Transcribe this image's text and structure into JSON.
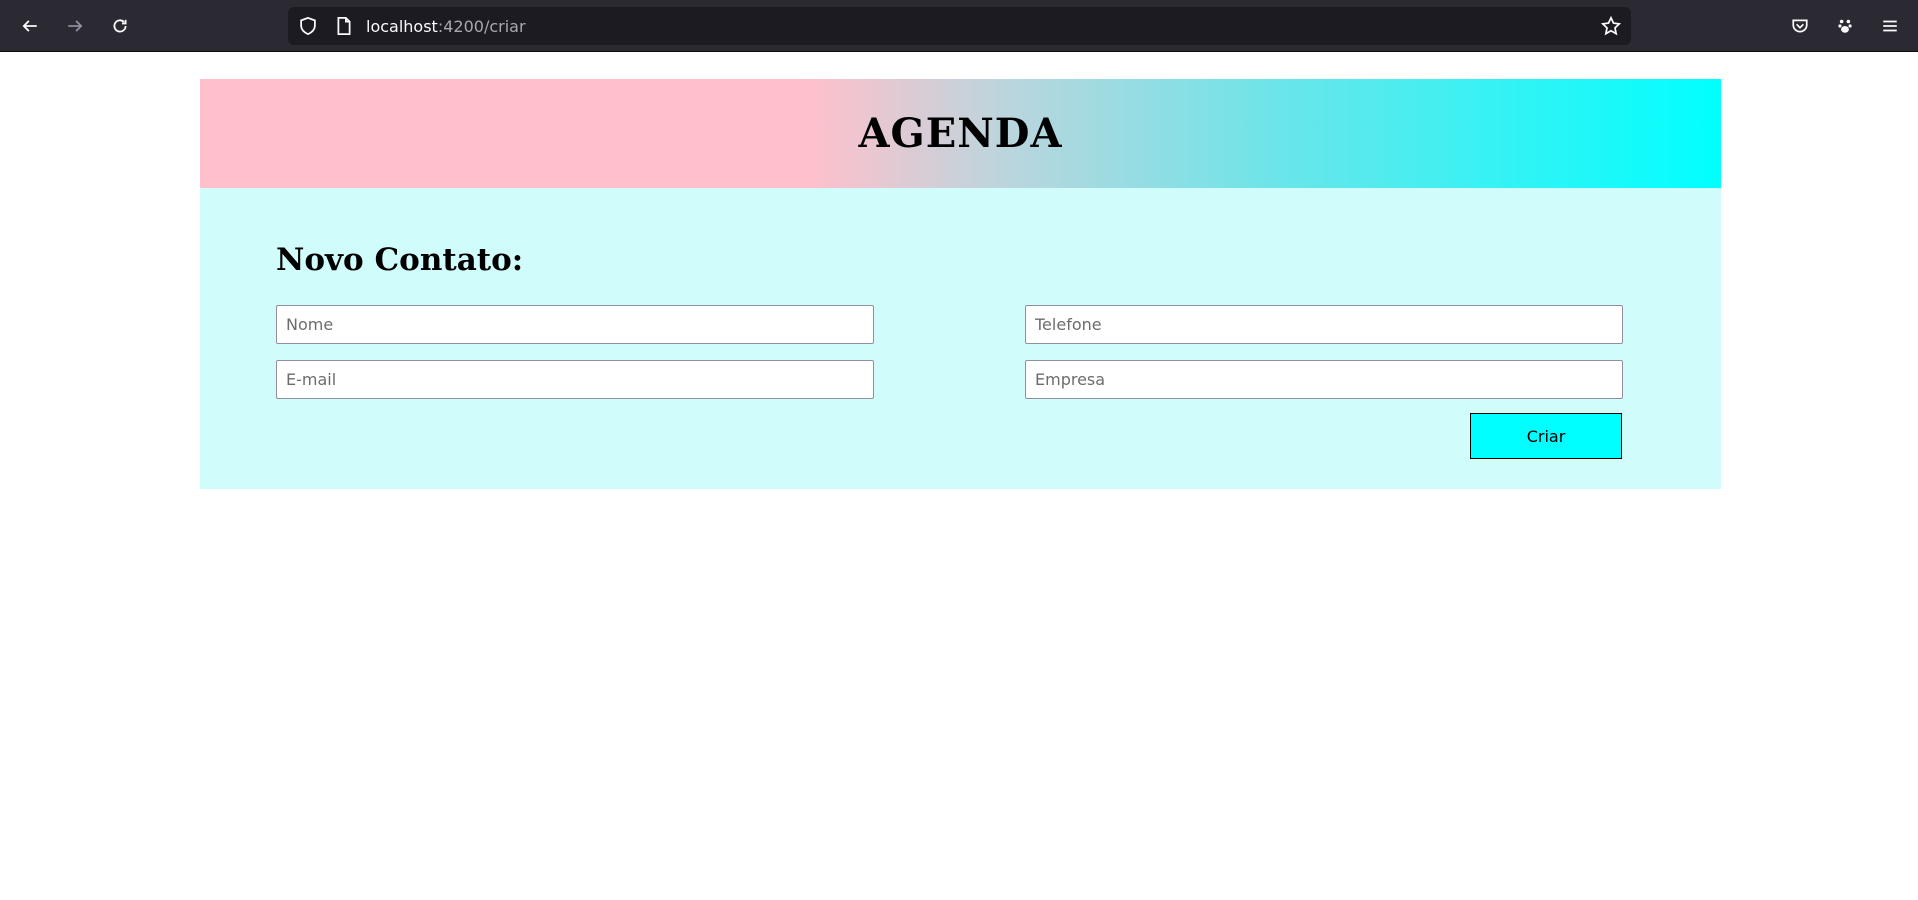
{
  "browser": {
    "url_host": "localhost",
    "url_path": ":4200/criar",
    "icons": [
      "back-icon",
      "forward-icon",
      "reload-icon",
      "shield-icon",
      "page-icon",
      "star-icon",
      "pocket-icon",
      "extension-icon",
      "menu-icon"
    ]
  },
  "header": {
    "title": "AGENDA"
  },
  "form": {
    "title": "Novo Contato:",
    "nome_placeholder": "Nome",
    "telefone_placeholder": "Telefone",
    "email_placeholder": "E-mail",
    "empresa_placeholder": "Empresa",
    "submit_label": "Criar"
  },
  "colors": {
    "header_gradient_start": "#ffc0cb",
    "header_gradient_end": "#00ffff",
    "form_background": "#d0fcfc",
    "button_background": "#00ffff"
  }
}
